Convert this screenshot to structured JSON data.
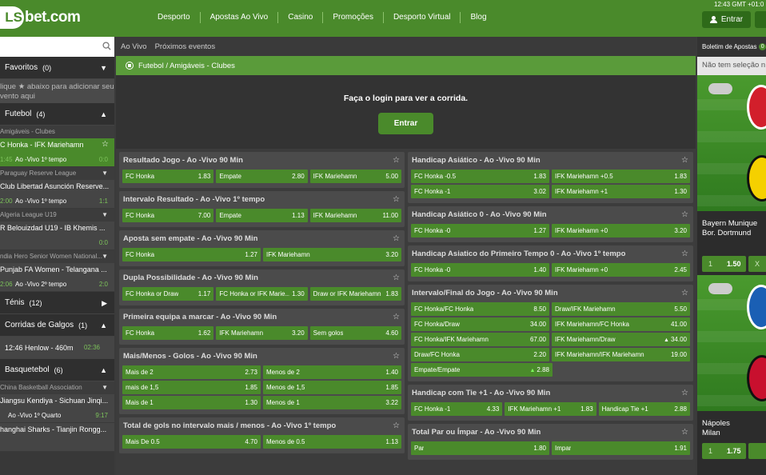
{
  "brand": {
    "logo_mark": "LS",
    "logo_text": "bet.com"
  },
  "nav": [
    "Desporto",
    "Apostas Ao Vivo",
    "Casino",
    "Promoções",
    "Desporto Virtual",
    "Blog"
  ],
  "header": {
    "clock": "12:43 GMT +01:0",
    "login_label": "Entrar"
  },
  "sidebar": {
    "favorites": {
      "label": "Favoritos",
      "count": "(0)",
      "note": "lique ★ abaixo para adicionar seu vento aqui"
    },
    "sports": [
      {
        "label": "Futebol",
        "count": "(4)"
      },
      {
        "label": "Ténis",
        "count": "(12)"
      },
      {
        "label": "Corridas de Galgos",
        "count": "(1)"
      },
      {
        "label": "Basquetebol",
        "count": "(6)"
      }
    ],
    "football_matches": [
      {
        "league": "Amigáveis - Clubes",
        "name": "C Honka - IFK Mariehamn",
        "time": "",
        "status": "",
        "score": "",
        "elapsed": "1:45",
        "status2": "Ao -Vivo 1º tempo",
        "score2": "0:0",
        "active": true
      },
      {
        "league": "Paraguay Reserve League",
        "name": "Club Libertad Asunción Reserve...",
        "elapsed": "2:00",
        "status2": "Ao -Vivo 1º tempo",
        "score2": "1:1"
      },
      {
        "league": "Algeria League U19",
        "name": "R Belouizdad U19 - IB Khemis ...",
        "elapsed": "",
        "status2": "",
        "score2": "0:0"
      },
      {
        "league": "ndia Hero Senior Women National...",
        "name": "Punjab FA Women - Telangana ...",
        "elapsed": "2:06",
        "status2": "Ao -Vivo 2º tempo",
        "score2": "2:0"
      }
    ],
    "greyhound": {
      "name": "12:46 Henlow - 460m",
      "time": "02:36"
    },
    "basketball": [
      {
        "league": "China Basketball Association",
        "name": "Jiangsu Kendiya - Sichuan Jinqi...",
        "status2": "Ao -Vivo 1º Quarto",
        "score2": "9:17"
      },
      {
        "league": "",
        "name": "hanghai Sharks - Tianjin Rongg..."
      }
    ]
  },
  "main": {
    "tabs": [
      "Ao Vivo",
      "Próximos eventos"
    ],
    "breadcrumb": "Futebol / Amigáveis - Clubes",
    "login_message": "Faça o login para ver a corrida.",
    "login_button": "Entrar"
  },
  "markets_left": [
    {
      "title": "Resultado Jogo - Ao -Vivo 90 Min",
      "rows": [
        [
          [
            "FC Honka",
            "1.83"
          ],
          [
            "Empate",
            "2.80"
          ],
          [
            "IFK Mariehamn",
            "5.00"
          ]
        ]
      ]
    },
    {
      "title": "Intervalo Resultado - Ao -Vivo 1º tempo",
      "rows": [
        [
          [
            "FC Honka",
            "7.00"
          ],
          [
            "Empate",
            "1.13"
          ],
          [
            "IFK Mariehamn",
            "11.00"
          ]
        ]
      ]
    },
    {
      "title": "Aposta sem empate - Ao -Vivo 90 Min",
      "rows": [
        [
          [
            "FC Honka",
            "1.27"
          ],
          [
            "IFK Mariehamn",
            "3.20"
          ]
        ]
      ]
    },
    {
      "title": "Dupla Possibilidade - Ao -Vivo 90 Min",
      "rows": [
        [
          [
            "FC Honka or Draw",
            "1.17"
          ],
          [
            "FC Honka or IFK Marie...",
            "1.30"
          ],
          [
            "Draw or IFK Mariehamn",
            "1.83"
          ]
        ]
      ]
    },
    {
      "title": "Primeira equipa a marcar - Ao -Vivo 90 Min",
      "rows": [
        [
          [
            "FC Honka",
            "1.62"
          ],
          [
            "IFK Mariehamn",
            "3.20"
          ],
          [
            "Sem golos",
            "4.60"
          ]
        ]
      ]
    },
    {
      "title": "Mais/Menos - Golos - Ao -Vivo 90 Min",
      "rows": [
        [
          [
            "Mais de 2",
            "2.73"
          ],
          [
            "Menos de 2",
            "1.40"
          ]
        ],
        [
          [
            "mais de 1,5",
            "1.85"
          ],
          [
            "Menos de 1,5",
            "1.85"
          ]
        ],
        [
          [
            "Mais de 1",
            "1.30"
          ],
          [
            "Menos de 1",
            "3.22"
          ]
        ]
      ]
    },
    {
      "title": "Total de gols no intervalo mais / menos - Ao -Vivo 1º tempo",
      "rows": [
        [
          [
            "Mais De 0.5",
            "4.70"
          ],
          [
            "Menos de 0.5",
            "1.13"
          ]
        ]
      ]
    }
  ],
  "markets_right": [
    {
      "title": "Handicap Asiático - Ao -Vivo 90 Min",
      "rows": [
        [
          [
            "FC Honka -0.5",
            "1.83"
          ],
          [
            "IFK Mariehamn +0.5",
            "1.83"
          ]
        ],
        [
          [
            "FC Honka -1",
            "3.02"
          ],
          [
            "IFK Mariehamn +1",
            "1.30"
          ]
        ]
      ]
    },
    {
      "title": "Handicap Asiático 0 - Ao -Vivo 90 Min",
      "rows": [
        [
          [
            "FC Honka -0",
            "1.27"
          ],
          [
            "IFK Mariehamn +0",
            "3.20"
          ]
        ]
      ]
    },
    {
      "title": "Handicap Asiatico do Primeiro Tempo 0 - Ao -Vivo 1º tempo",
      "rows": [
        [
          [
            "FC Honka -0",
            "1.40"
          ],
          [
            "IFK Mariehamn +0",
            "2.45"
          ]
        ]
      ]
    },
    {
      "title": "Intervalo/Final do Jogo - Ao -Vivo 90 Min",
      "rows": [
        [
          [
            "FC Honka/FC Honka",
            "8.50"
          ],
          [
            "Draw/IFK Mariehamn",
            "5.50"
          ]
        ],
        [
          [
            "FC Honka/Draw",
            "34.00"
          ],
          [
            "IFK Mariehamn/FC Honka",
            "41.00"
          ]
        ],
        [
          [
            "FC Honka/IFK Mariehamn",
            "67.00"
          ],
          [
            "IFK Mariehamn/Draw",
            "34.00",
            "up"
          ]
        ],
        [
          [
            "Draw/FC Honka",
            "2.20"
          ],
          [
            "IFK Mariehamn/IFK Mariehamn",
            "19.00"
          ]
        ],
        [
          [
            "Empate/Empate",
            "2.88",
            "upg"
          ]
        ]
      ]
    },
    {
      "title": "Handicap com Tie +1 - Ao -Vivo 90 Min",
      "rows": [
        [
          [
            "FC Honka -1",
            "4.33"
          ],
          [
            "IFK Mariehamn +1",
            "1.83"
          ],
          [
            "Handicap Tie +1",
            "2.88"
          ]
        ]
      ]
    },
    {
      "title": "Total Par ou Ímpar - Ao -Vivo 90 Min",
      "rows": [
        [
          [
            "Par",
            "1.80"
          ],
          [
            "Impar",
            "1.91"
          ]
        ]
      ]
    }
  ],
  "betslip": {
    "title": "Boletim de Apostas",
    "badge": "0",
    "note": "Não tem seleção n",
    "promos": [
      {
        "home": "Bayern Munique",
        "away": "Bor. Dortmund",
        "odd1_label": "1",
        "odd1": "1.50",
        "oddx_label": "X"
      },
      {
        "home": "Nápoles",
        "away": "Milan",
        "odd1_label": "1",
        "odd1": "1.75"
      }
    ]
  },
  "colors": {
    "brand_green": "#4a8a2b",
    "dark_bg": "#3b3b3b",
    "odd_green": "#4a8a2b"
  }
}
